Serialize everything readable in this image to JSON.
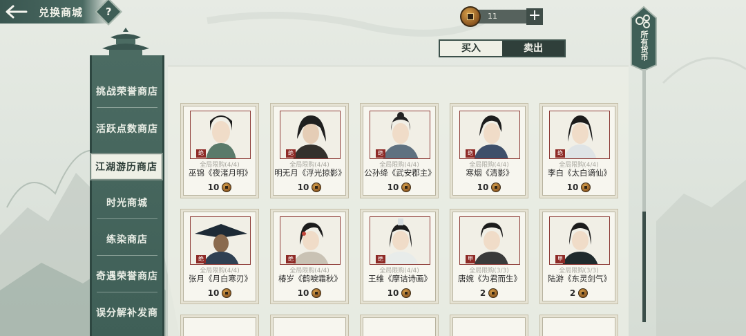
{
  "header": {
    "title": "兑换商城",
    "help_label": "?",
    "currency_amount": "11",
    "add_label": "+"
  },
  "tabs": [
    {
      "label": "买入",
      "active": true
    },
    {
      "label": "卖出",
      "active": false
    }
  ],
  "currency_tag": {
    "label": "所有货币"
  },
  "sidebar": {
    "items": [
      {
        "label": "挑战荣誉商店",
        "active": false
      },
      {
        "label": "活跃点数商店",
        "active": false
      },
      {
        "label": "江湖游历商店",
        "active": true
      },
      {
        "label": "时光商城",
        "active": false
      },
      {
        "label": "练染商店",
        "active": false
      },
      {
        "label": "奇遇荣誉商店",
        "active": false
      },
      {
        "label": "误分解补发商",
        "active": false
      }
    ]
  },
  "items": [
    {
      "limit": "全局限购(4/4)",
      "name": "巫锦《夜渚月明》",
      "price": "10",
      "grade": "绝"
    },
    {
      "limit": "全局限购(4/4)",
      "name": "明无月《浮光掠影》",
      "price": "10",
      "grade": "绝"
    },
    {
      "limit": "全局限购(4/4)",
      "name": "公孙绛《武安郡主》",
      "price": "10",
      "grade": "绝"
    },
    {
      "limit": "全局限购(4/4)",
      "name": "寒烟《清影》",
      "price": "10",
      "grade": "绝"
    },
    {
      "limit": "全局限购(4/4)",
      "name": "李白《太白谪仙》",
      "price": "10",
      "grade": "绝"
    },
    {
      "limit": "全局限购(4/4)",
      "name": "张月《月白寒刃》",
      "price": "10",
      "grade": "绝"
    },
    {
      "limit": "全局限购(4/4)",
      "name": "椿岁《鹤唳霜秋》",
      "price": "10",
      "grade": "绝"
    },
    {
      "limit": "全局限购(4/4)",
      "name": "王维《摩诘诗画》",
      "price": "10",
      "grade": "绝"
    },
    {
      "limit": "全局限购(3/3)",
      "name": "唐婉《为君而生》",
      "price": "2",
      "grade": "甲"
    },
    {
      "limit": "全局限购(3/3)",
      "name": "陆游《东灵剑气》",
      "price": "2",
      "grade": "甲"
    }
  ],
  "colors": {
    "accent_dark": "#3f5f57",
    "grade_red": "#8e2a26",
    "coin": "#b07a35"
  }
}
